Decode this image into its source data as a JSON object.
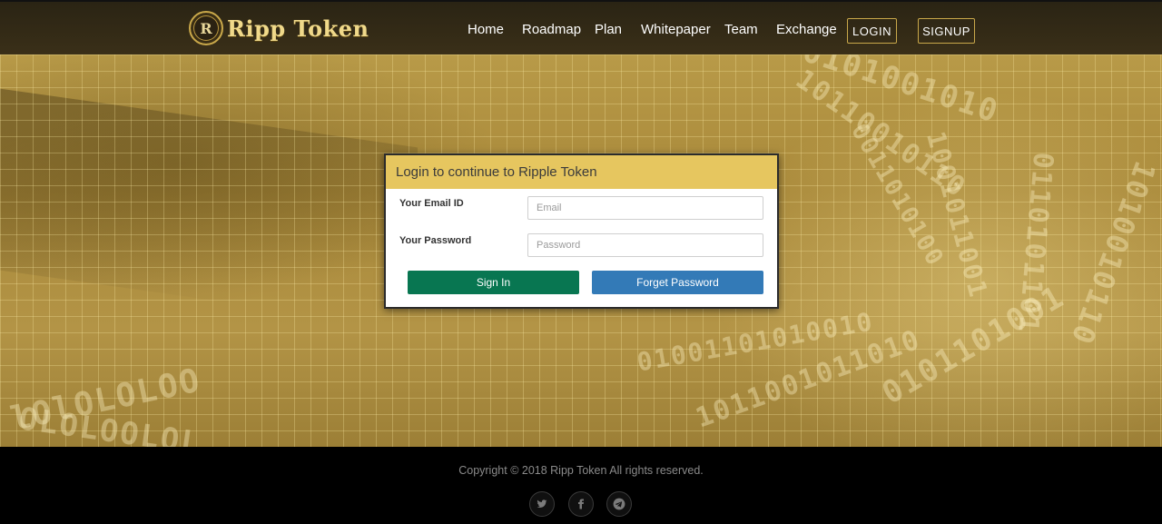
{
  "brand": {
    "logo_letter": "R",
    "name": "Ripp Token"
  },
  "nav": {
    "links": [
      "Home",
      "Roadmap",
      "Plan",
      "Whitepaper",
      "Team",
      "Exchange"
    ],
    "login_label": "LOGIN",
    "signup_label": "SIGNUP"
  },
  "login_card": {
    "title": "Login to continue to Ripple Token",
    "email_label": "Your Email ID",
    "email_placeholder": "Email",
    "email_value": "",
    "password_label": "Your Password",
    "password_placeholder": "Password",
    "password_value": "",
    "sign_in_label": "Sign In",
    "forget_password_label": "Forget Password"
  },
  "footer": {
    "copyright": "Copyright © 2018 Ripp Token All rights reserved.",
    "social_icons": [
      "twitter-icon",
      "facebook-icon",
      "telegram-icon"
    ]
  },
  "colors": {
    "header_bg": "#3a2f18",
    "accent_gold": "#e6c65f",
    "sign_in_bg": "#087651",
    "forget_password_bg": "#337ab7",
    "footer_bg": "#000000"
  }
}
